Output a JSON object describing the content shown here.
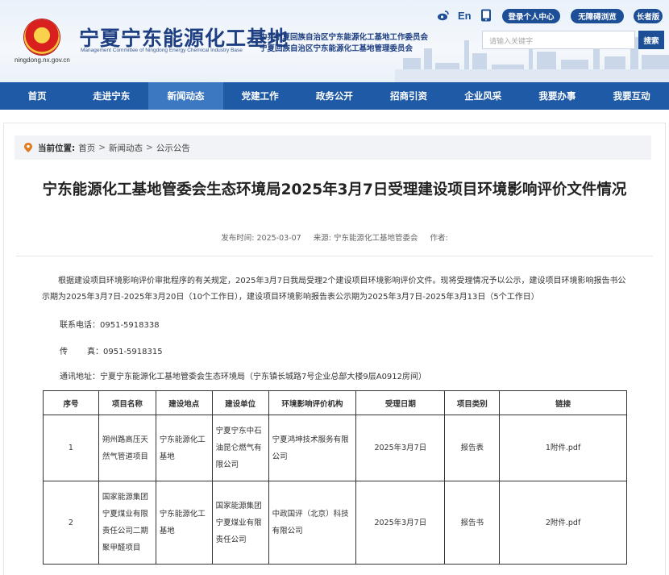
{
  "header": {
    "site_url": "ningdong.nx.gov.cn",
    "site_title": "宁夏宁东能源化工基地",
    "site_title_en": "Management Committee of Ningdong Energy Chemical Industry Base",
    "org_line_1": "中共宁夏回族自治区宁东能源化工基地工作委员会",
    "org_line_2": "宁夏回族自治区宁东能源化工基地管理委员会",
    "lang_label": "En",
    "login_label": "登录个人中心",
    "barrier_free_label": "无障碍浏览",
    "elder_label": "长者版",
    "search_placeholder": "请输入关键字",
    "search_button": "搜索",
    "icons": [
      "weibo-icon",
      "language-icon",
      "mobile-icon"
    ]
  },
  "nav": {
    "items": [
      "首页",
      "走进宁东",
      "新闻动态",
      "党建工作",
      "政务公开",
      "招商引资",
      "企业风采",
      "我要办事",
      "我要互动"
    ],
    "active_index": 2
  },
  "breadcrumb": {
    "label": "当前位置:",
    "items": [
      "首页",
      "新闻动态",
      "公示公告"
    ],
    "separator": ">"
  },
  "article": {
    "title": "宁东能源化工基地管委会生态环境局2025年3月7日受理建设项目环境影响评价文件情况",
    "publish_time_label": "发布时间:",
    "publish_time": "2025-03-07",
    "source_label": "来源:",
    "source": "宁东能源化工基地管委会",
    "author_label": "作者:",
    "author": "",
    "paragraph": "根据建设项目环境影响评价审批程序的有关规定，2025年3月7日我局受理2个建设项目环境影响评价文件。现将受理情况予以公示，建设项目环境影响报告书公示期为2025年3月7日-2025年3月20日（10个工作日），建设项目环境影响报告表公示期为2025年3月7日-2025年3月13日（5个工作日）",
    "phone_label": "联系电话：",
    "phone": "0951-5918338",
    "fax_label_1": "传",
    "fax_label_2": "真：",
    "fax": "0951-5918315",
    "address_label": "通讯地址：",
    "address": "宁夏宁东能源化工基地管委会生态环境局（宁东镇长城路7号企业总部大楼9层A0912房间）"
  },
  "table": {
    "headers": [
      "序号",
      "项目名称",
      "建设地点",
      "建设单位",
      "环境影响评价机构",
      "受理日期",
      "项目类别",
      "链接"
    ],
    "rows": [
      {
        "no": "1",
        "name": "朔州路高压天然气管道项目",
        "location": "宁东能源化工基地",
        "builder": "宁夏宁东中石油昆仑燃气有限公司",
        "agency": "宁夏鸿坤技术服务有限公司",
        "date": "2025年3月7日",
        "category": "报告表",
        "link": "1附件.pdf"
      },
      {
        "no": "2",
        "name": "国家能源集团宁夏煤业有限责任公司二期聚甲醛项目",
        "location": "宁东能源化工基地",
        "builder": "国家能源集团宁夏煤业有限责任公司",
        "agency": "中政国评（北京）科技有限公司",
        "date": "2025年3月7日",
        "category": "报告书",
        "link": "2附件.pdf"
      }
    ]
  }
}
